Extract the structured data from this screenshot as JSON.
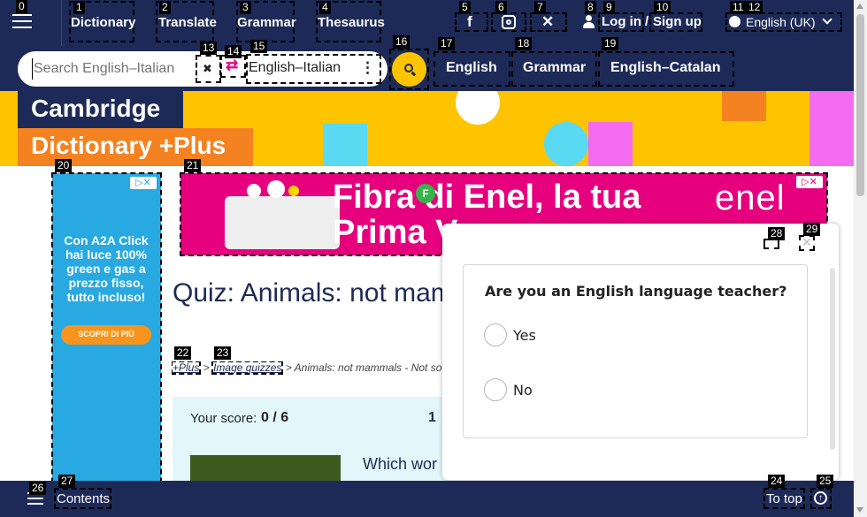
{
  "nav": {
    "dictionary": "Dictionary",
    "translate": "Translate",
    "grammar": "Grammar",
    "thesaurus": "Thesaurus",
    "login": "Log in",
    "separator": "/",
    "signup": "Sign up",
    "language": "English (UK)"
  },
  "search": {
    "placeholder": "Search English–Italian",
    "clear": "✖",
    "swap": "⇄",
    "language_pair": "English–Italian",
    "more": "⋮"
  },
  "dict_tabs": [
    "English",
    "Grammar",
    "English–Catalan"
  ],
  "brand": {
    "line1": "Cambridge",
    "line2": "Dictionary +Plus"
  },
  "ads": {
    "left_text": "Con A2A Click hai luce 100% green e gas a prezzo fisso, tutto incluso!",
    "left_button": "SCOPRI DI PIÙ",
    "top_text_line1": "Fibra di Enel, la tua",
    "top_text_line2": "Prima V",
    "top_badge": "F",
    "top_brand": "enel"
  },
  "page": {
    "title": "Quiz: Animals: not mam",
    "breadcrumb_plus": "+Plus",
    "breadcrumb_sep": ">",
    "breadcrumb_quizzes": "Image quizzes",
    "breadcrumb_rest": "> Animals: not mammals - Not so",
    "score_label": "Your score:",
    "score_value": "0 / 6",
    "question_number": "1",
    "question_text": "Which wor"
  },
  "popup": {
    "question": "Are you an English language teacher?",
    "option_yes": "Yes",
    "option_no": "No"
  },
  "bottom": {
    "contents": "Contents",
    "to_top": "To top"
  },
  "colors": {
    "navy": "#1d2a57",
    "yellow": "#fec400",
    "enel_pink": "#e6007e",
    "a2a_blue": "#29a9e1"
  }
}
